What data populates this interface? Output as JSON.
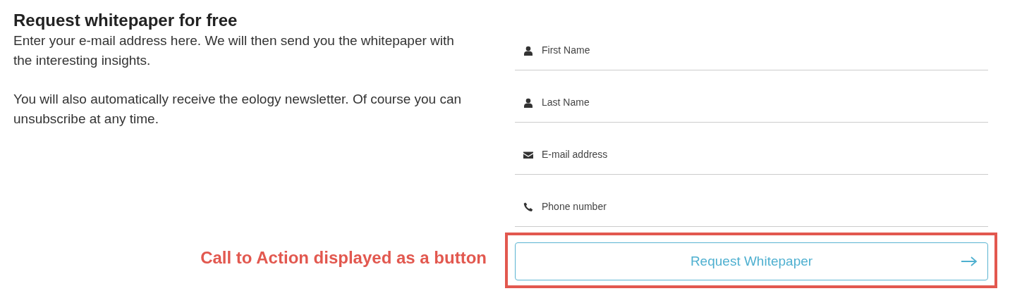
{
  "intro": {
    "title": "Request whitepaper for free",
    "paragraphs": [
      "Enter your e-mail address here. We will then send you the whitepaper with the interesting insights.",
      "You will also automatically receive the eology newsletter. Of course you can unsubscribe at any time."
    ]
  },
  "fields": [
    {
      "kind": "person",
      "placeholder": "First Name"
    },
    {
      "kind": "person",
      "placeholder": "Last Name"
    },
    {
      "kind": "email",
      "placeholder": "E-mail address"
    },
    {
      "kind": "phone",
      "placeholder": "Phone number"
    }
  ],
  "button": {
    "label": "Request Whitepaper"
  },
  "annotation": {
    "label": "Call to Action displayed as a button"
  }
}
